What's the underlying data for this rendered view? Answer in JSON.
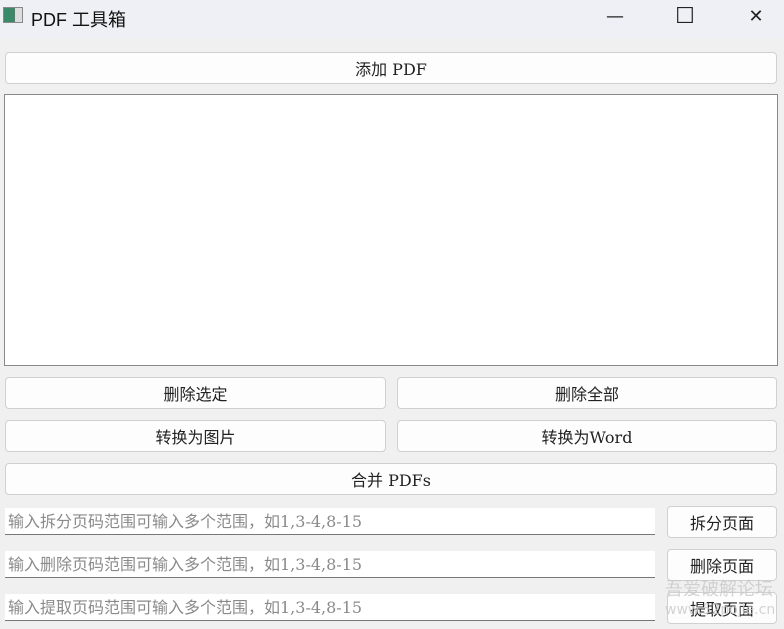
{
  "window": {
    "title": "PDF 工具箱",
    "minimize": "—",
    "maximize": "☐",
    "close": "✕"
  },
  "buttons": {
    "add": "添加 PDF",
    "delete_selected": "删除选定",
    "delete_all": "删除全部",
    "to_image": "转换为图片",
    "to_word": "转换为Word",
    "merge": "合并 PDFs",
    "split": "拆分页面",
    "delete_pages": "删除页面",
    "extract": "提取页面"
  },
  "inputs": {
    "split_placeholder": "输入拆分页码范围可输入多个范围，如1,3-4,8-15",
    "delete_placeholder": "输入删除页码范围可输入多个范围，如1,3-4,8-15",
    "extract_placeholder": "输入提取页码范围可输入多个范围，如1,3-4,8-15"
  },
  "watermark": {
    "line1": "吾爱破解论坛",
    "line2": "www.52pojie.cn"
  }
}
